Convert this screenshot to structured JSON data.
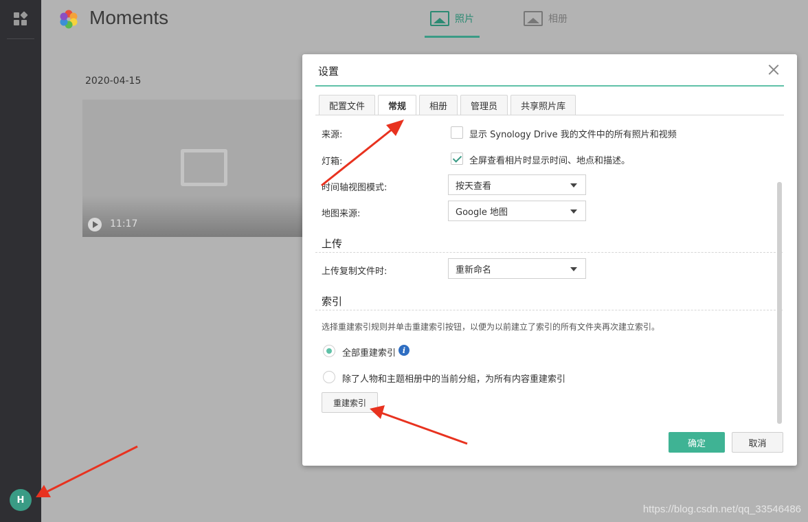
{
  "app": {
    "title": "Moments",
    "avatar_initial": "H"
  },
  "header_tabs": [
    {
      "label": "照片",
      "icon": "photo-icon"
    },
    {
      "label": "相册",
      "icon": "album-icon"
    }
  ],
  "timeline": {
    "date": "2020-04-15",
    "video_duration": "11:17"
  },
  "dialog": {
    "title": "设置",
    "tabs": [
      "配置文件",
      "常规",
      "相册",
      "管理员",
      "共享照片库"
    ],
    "active_tab": "常规",
    "source_label": "来源:",
    "source_checkbox": "显示 Synology Drive 我的文件中的所有照片和视频",
    "lightbox_label": "灯箱:",
    "lightbox_checkbox": "全屏查看相片时显示时间、地点和描述。",
    "timeline_mode_label": "时间轴视图模式:",
    "timeline_mode_value": "按天查看",
    "map_source_label": "地图来源:",
    "map_source_value": "Google 地图",
    "upload_heading": "上传",
    "upload_dup_label": "上传复制文件时:",
    "upload_dup_value": "重新命名",
    "index_heading": "索引",
    "index_desc": "选择重建索引规则并单击重建索引按钮，以便为以前建立了索引的所有文件夹再次建立索引。",
    "radio_all": "全部重建索引",
    "radio_except": "除了人物和主题相册中的当前分組，为所有内容重建索引",
    "rebuild_button": "重建索引",
    "ok_button": "确定",
    "cancel_button": "取消"
  },
  "watermark": "https://blog.csdn.net/qq_33546486",
  "colors": {
    "accent": "#3a9b85",
    "ok_button": "#3fb394",
    "title_line": "#5fc1a7",
    "annotation_arrow": "#e8321f"
  }
}
